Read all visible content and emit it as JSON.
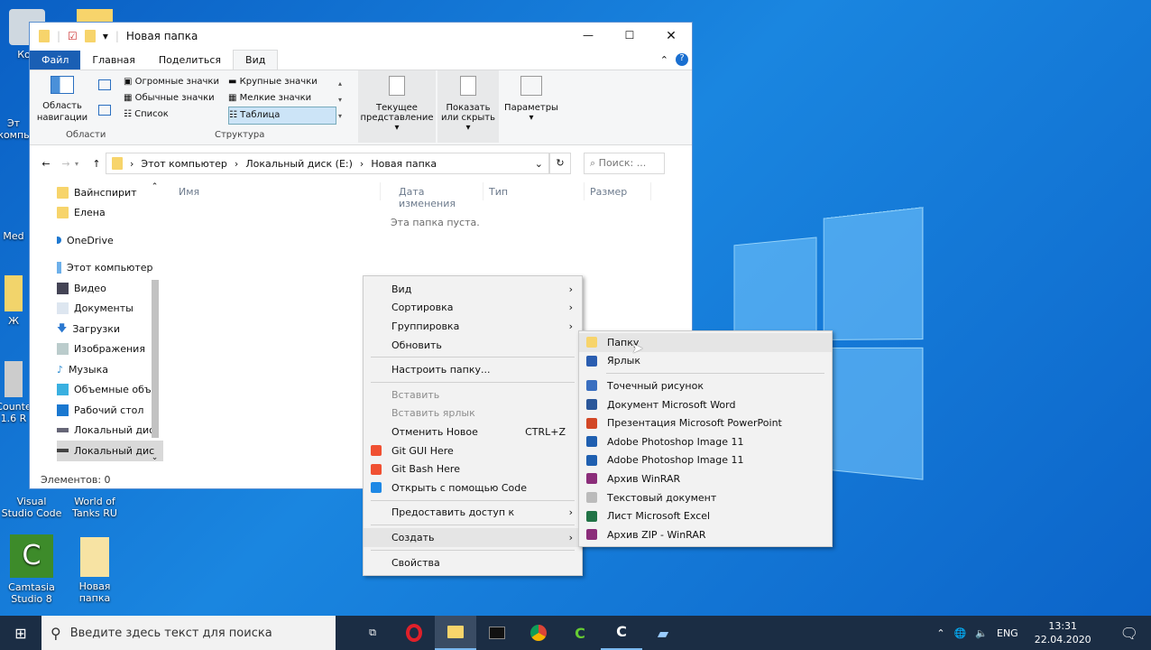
{
  "desktop": {
    "icons": [
      {
        "label": "Кор"
      },
      {
        "label": "Эт компь"
      },
      {
        "label": "Med"
      },
      {
        "label": "Ж"
      },
      {
        "label": "Counte 1.6 R"
      },
      {
        "label": "Visual Studio Code"
      },
      {
        "label": "World of Tanks RU"
      },
      {
        "label": "Camtasia Studio 8"
      },
      {
        "label": "Новая папка"
      }
    ]
  },
  "explorer": {
    "title": "Новая папка",
    "tabs": [
      "Файл",
      "Главная",
      "Поделиться",
      "Вид"
    ],
    "active_tab": "Вид",
    "ribbon": {
      "nav_pane": "Область навигации",
      "group_areas": "Области",
      "layouts": [
        "Огромные значки",
        "Крупные значки",
        "Обычные значки",
        "Мелкие значки",
        "Список",
        "Таблица"
      ],
      "selected_layout": "Таблица",
      "group_structure": "Структура",
      "current_view": "Текущее представление",
      "show_hide": "Показать или скрыть",
      "options": "Параметры"
    },
    "address": [
      "Этот компьютер",
      "Локальный диск (E:)",
      "Новая папка"
    ],
    "search_placeholder": "Поиск: ...",
    "sidebar": [
      "Вайнспирит",
      "Елена",
      "OneDrive",
      "Этот компьютер",
      "Видео",
      "Документы",
      "Загрузки",
      "Изображения",
      "Музыка",
      "Объемные объ",
      "Рабочий стол",
      "Локальный дис",
      "Локальный дис"
    ],
    "columns": [
      "Имя",
      "Дата изменения",
      "Тип",
      "Размер"
    ],
    "empty_text": "Эта папка пуста.",
    "status": "Элементов: 0"
  },
  "context_menu": [
    {
      "label": "Вид",
      "submenu": true
    },
    {
      "label": "Сортировка",
      "submenu": true
    },
    {
      "label": "Группировка",
      "submenu": true
    },
    {
      "label": "Обновить"
    },
    {
      "sep": true
    },
    {
      "label": "Настроить папку..."
    },
    {
      "sep": true
    },
    {
      "label": "Вставить",
      "disabled": true
    },
    {
      "label": "Вставить ярлык",
      "disabled": true
    },
    {
      "label": "Отменить Новое",
      "shortcut": "CTRL+Z"
    },
    {
      "label": "Git GUI Here",
      "icon": "git-icon"
    },
    {
      "label": "Git Bash Here",
      "icon": "git-icon"
    },
    {
      "label": "Открыть с помощью Code",
      "icon": "vscode-icon"
    },
    {
      "sep": true
    },
    {
      "label": "Предоставить доступ к",
      "submenu": true
    },
    {
      "sep": true
    },
    {
      "label": "Создать",
      "submenu": true,
      "highlighted": true
    },
    {
      "sep": true
    },
    {
      "label": "Свойства"
    }
  ],
  "create_submenu": [
    {
      "label": "Папку",
      "icon": "folder-icon",
      "color": "#f7d46b",
      "highlighted": true
    },
    {
      "label": "Ярлык",
      "icon": "shortcut-icon",
      "color": "#2a5db0"
    },
    {
      "sep": true
    },
    {
      "label": "Точечный рисунок",
      "icon": "bitmap-icon",
      "color": "#3a6fc0"
    },
    {
      "label": "Документ Microsoft Word",
      "icon": "word-icon",
      "color": "#2b579a"
    },
    {
      "label": "Презентация Microsoft PowerPoint",
      "icon": "powerpoint-icon",
      "color": "#d24726"
    },
    {
      "label": "Adobe Photoshop Image 11",
      "icon": "photoshop-icon",
      "color": "#1f5fb0"
    },
    {
      "label": "Adobe Photoshop Image 11",
      "icon": "photoshop-icon",
      "color": "#1f5fb0"
    },
    {
      "label": "Архив WinRAR",
      "icon": "winrar-icon",
      "color": "#8b2d7a"
    },
    {
      "label": "Текстовый документ",
      "icon": "text-icon",
      "color": "#bbbbbb"
    },
    {
      "label": "Лист Microsoft Excel",
      "icon": "excel-icon",
      "color": "#217346"
    },
    {
      "label": "Архив ZIP - WinRAR",
      "icon": "winrar-icon",
      "color": "#8b2d7a"
    }
  ],
  "taskbar": {
    "search_placeholder": "Введите здесь текст для поиска",
    "language": "ENG",
    "time": "13:31",
    "date": "22.04.2020"
  }
}
